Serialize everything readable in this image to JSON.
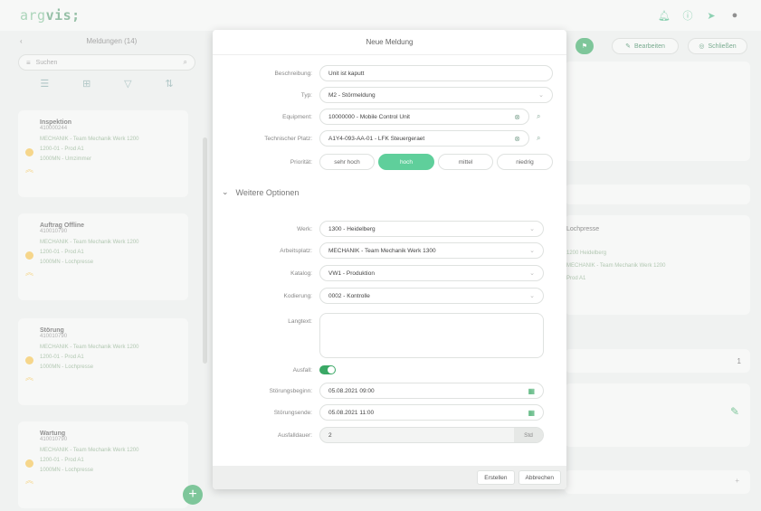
{
  "app": {
    "logo_prefix": "arg",
    "logo_suffix": "vis;"
  },
  "background": {
    "left_panel": {
      "title": "Meldungen (14)",
      "search_placeholder": "Suchen",
      "cards": [
        {
          "title": "Inspektion",
          "number": "410000244",
          "lines": [
            "MECHANIK - Team Mechanik Werk 1200",
            "1200-01 - Prod A1",
            "1000MN - Umzimmer"
          ]
        },
        {
          "title": "Auftrag Offline",
          "number": "410010790",
          "lines": [
            "MECHANIK - Team Mechanik Werk 1200",
            "1200-01 - Prod A1",
            "1000MN - Lochpresse"
          ]
        },
        {
          "title": "Störung",
          "number": "410010790",
          "lines": [
            "MECHANIK - Team Mechanik Werk 1200",
            "1200-01 - Prod A1",
            "1000MN - Lochpresse"
          ]
        },
        {
          "title": "Wartung",
          "number": "410010790",
          "lines": [
            "MECHANIK - Team Mechanik Werk 1200",
            "1200-01 - Prod A1",
            "1000MN - Lochpresse"
          ]
        }
      ]
    },
    "right": {
      "btn_edit": "Bearbeiten",
      "btn_close": "Schließen",
      "card_title": "Lochpresse",
      "card_lines": [
        "1200 Heidelberg",
        "MECHANIK - Team Mechanik Werk 1200",
        "Prod A1"
      ],
      "count": "1"
    }
  },
  "modal": {
    "title": "Neue Meldung",
    "fields": {
      "beschreibung": {
        "label": "Beschreibung:",
        "value": "Unit ist kaputt"
      },
      "typ": {
        "label": "Typ:",
        "value": "M2 - Störmeldung"
      },
      "equipment": {
        "label": "Equipment:",
        "value": "10000000 - Mobile Control Unit"
      },
      "techplatz": {
        "label": "Technischer Platz:",
        "value": "A1Y4-093-AA-01 - LFK Steuergeraet"
      },
      "prioritaet": {
        "label": "Priorität:",
        "options": [
          "sehr hoch",
          "hoch",
          "mittel",
          "niedrig"
        ],
        "selected": "hoch"
      }
    },
    "section_label": "Weitere Optionen",
    "more": {
      "werk": {
        "label": "Werk:",
        "value": "1300 - Heidelberg"
      },
      "arbeitsplatz": {
        "label": "Arbeitsplatz:",
        "value": "MECHANIK - Team Mechanik Werk 1300"
      },
      "katalog": {
        "label": "Katalog:",
        "value": "VW1 - Produktion"
      },
      "codierung": {
        "label": "Kodierung:",
        "value": "0002 - Kontrolle"
      },
      "langtext": {
        "label": "Langtext:",
        "value": ""
      },
      "ausfall": {
        "label": "Ausfall:",
        "on": true
      },
      "stoerungsbeginn": {
        "label": "Störungsbeginn:",
        "value": "05.08.2021 09:00"
      },
      "stoerungsende": {
        "label": "Störungsende:",
        "value": "05.08.2021 11:00"
      },
      "ausfalldauer": {
        "label": "Ausfalldauer:",
        "value": "2",
        "unit": "Std"
      }
    },
    "footer": {
      "create": "Erstellen",
      "cancel": "Abbrechen"
    }
  },
  "colors": {
    "accent": "#3aa865",
    "priority_active": "#5fcf9b",
    "warning": "#f2c14e"
  }
}
